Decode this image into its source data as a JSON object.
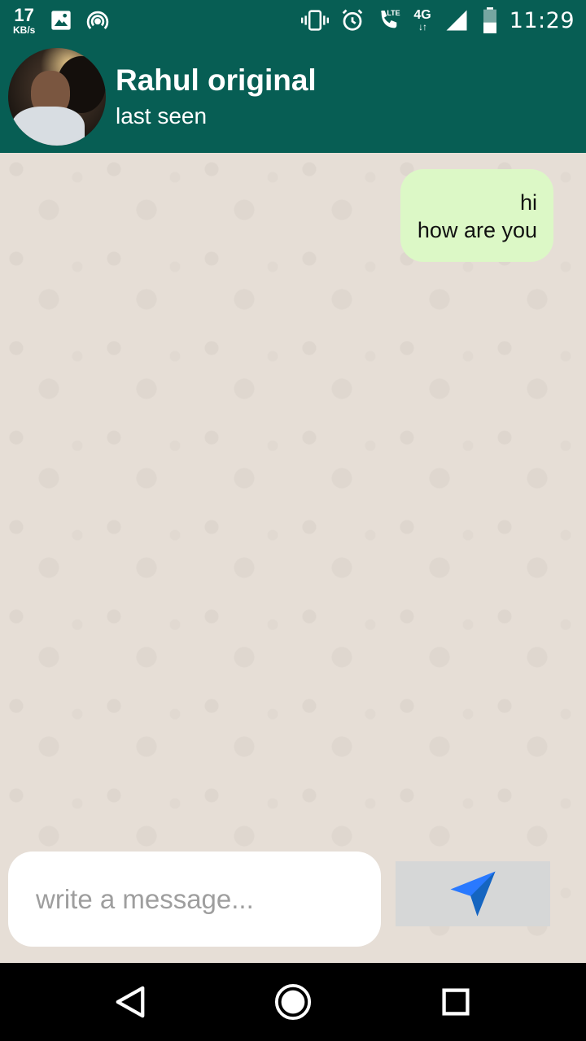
{
  "status_bar": {
    "net_speed_value": "17",
    "net_speed_unit": "KB/s",
    "lte_label": "LTE",
    "network_type": "4G",
    "time": "11:29",
    "icons": [
      "image-icon",
      "hotspot-icon",
      "vibrate-icon",
      "alarm-icon",
      "lte-call-icon",
      "data-arrows-icon",
      "signal-icon",
      "battery-icon"
    ]
  },
  "header": {
    "contact_name": "Rahul original",
    "status": "last seen",
    "background_color": "#075e54"
  },
  "messages": [
    {
      "lines": [
        "hi",
        "how are you"
      ],
      "outgoing": true,
      "bubble_color": "#dcf8c6"
    }
  ],
  "composer": {
    "placeholder": "write a message...",
    "send_icon": "send-arrow-icon",
    "send_icon_color": "#2979ff"
  },
  "nav_bar": {
    "icons": [
      "back-icon",
      "home-icon",
      "recents-icon"
    ]
  }
}
